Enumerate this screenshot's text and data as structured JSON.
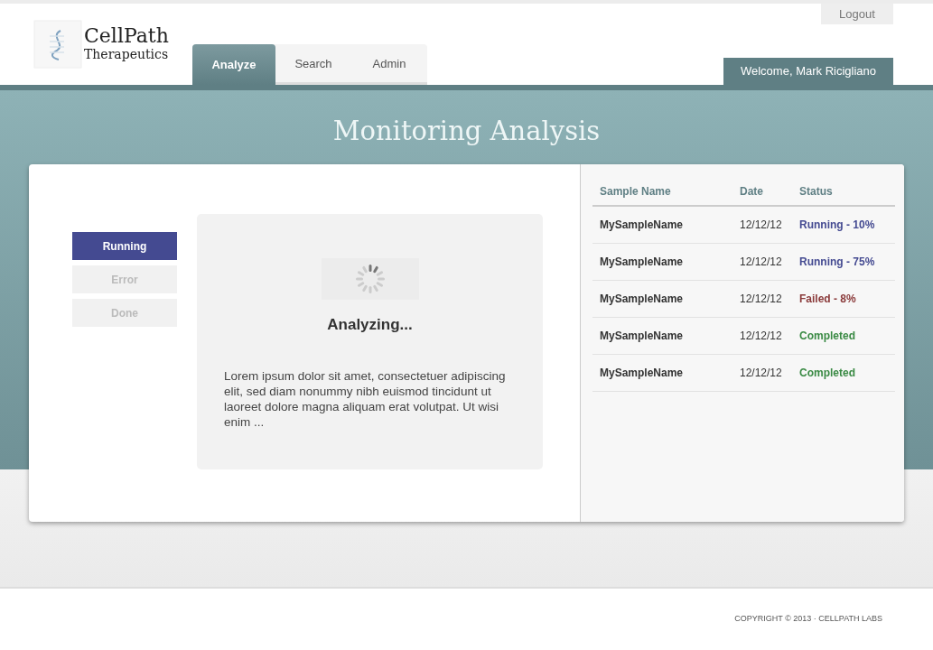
{
  "logo": {
    "name": "CellPath",
    "tagline": "Therapeutics"
  },
  "tabs": [
    {
      "label": "Analyze",
      "selected": true
    },
    {
      "label": "Search",
      "selected": false
    },
    {
      "label": "Admin",
      "selected": false
    }
  ],
  "logout": "Logout",
  "welcome": "Welcome, Mark Ricigliano",
  "page_title": "Monitoring Analysis",
  "filters": [
    {
      "label": "Running",
      "selected": true
    },
    {
      "label": "Error",
      "selected": false
    },
    {
      "label": "Done",
      "selected": false
    }
  ],
  "analysis": {
    "heading": "Analyzing...",
    "text": "Lorem ipsum dolor sit amet, consectetuer adipiscing elit, sed diam nonummy nibh euismod tincidunt ut laoreet dolore magna aliquam erat volutpat. Ut wisi enim ..."
  },
  "table": {
    "columns": [
      "Sample Name",
      "Date",
      "Status"
    ],
    "rows": [
      {
        "name": "MySampleName",
        "date": "12/12/12",
        "status": "Running - 10%",
        "color": "#444a91"
      },
      {
        "name": "MySampleName",
        "date": "12/12/12",
        "status": "Running - 75%",
        "color": "#444a91"
      },
      {
        "name": "MySampleName",
        "date": "12/12/12",
        "status": "Failed - 8%",
        "color": "#8a3a3a"
      },
      {
        "name": "MySampleName",
        "date": "12/12/12",
        "status": "Completed",
        "color": "#3a8a44"
      },
      {
        "name": "MySampleName",
        "date": "12/12/12",
        "status": "Completed",
        "color": "#3a8a44"
      }
    ]
  },
  "footer": "COPYRIGHT © 2013 · CELLPATH LABS"
}
